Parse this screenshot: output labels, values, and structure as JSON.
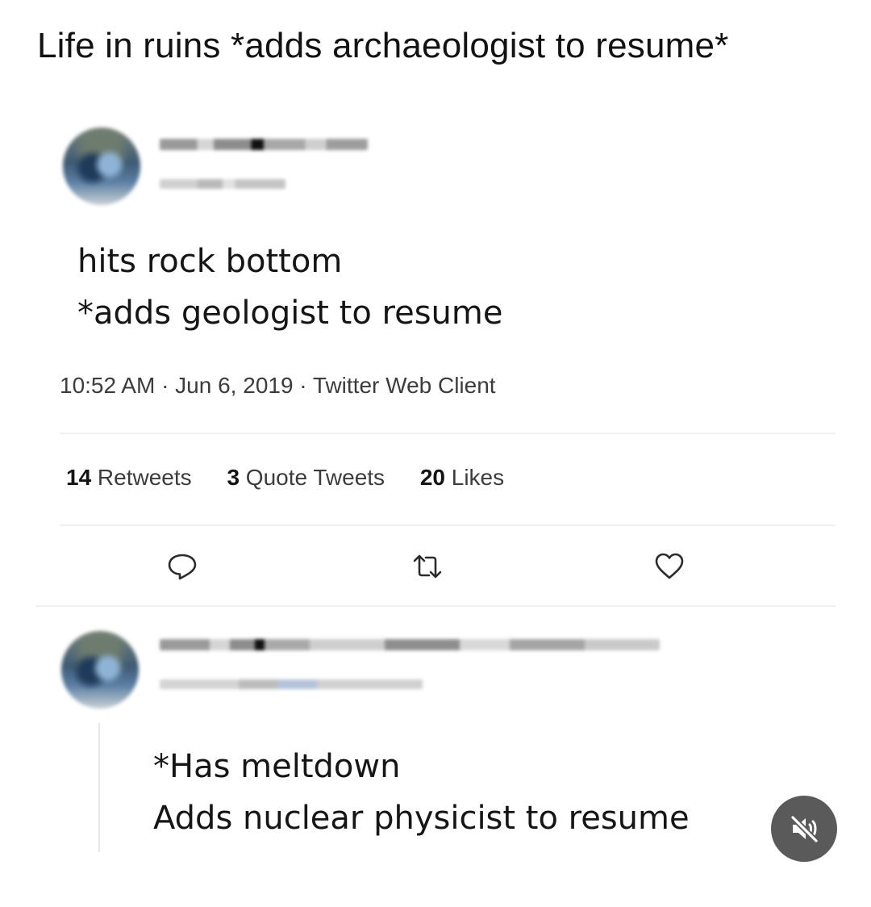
{
  "caption": "Life in ruins  *adds archaeologist to resume*",
  "tweet": {
    "line1": "hits rock bottom",
    "line2": "*adds geologist to resume",
    "meta": "10:52 AM · Jun 6, 2019 · Twitter Web Client",
    "retweets_count": "14",
    "retweets_label": " Retweets",
    "quotes_count": "3",
    "quotes_label": " Quote Tweets",
    "likes_count": "20",
    "likes_label": " Likes"
  },
  "actions": {
    "reply_icon": "reply-icon",
    "retweet_icon": "retweet-icon",
    "like_icon": "heart-icon"
  },
  "reply": {
    "line1": "*Has meltdown",
    "line2": "Adds nuclear physicist to resume"
  },
  "overlay": {
    "mute_icon": "muted-speaker-icon"
  },
  "colors": {
    "background": "#ffffff",
    "text": "#151515",
    "muted_text": "#3c3c3c",
    "mute_button": "#5a5a5a"
  }
}
